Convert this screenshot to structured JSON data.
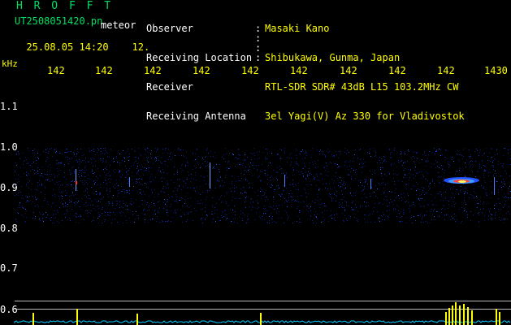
{
  "header": {
    "brand": "H R O F F T",
    "filename": "UT2508051420.pn",
    "mode": "meteor",
    "datetime": "25.08.05 14:20",
    "counter": "12.",
    "fields": [
      {
        "label": "Observer",
        "value": "Masaki Kano"
      },
      {
        "label": "Receiving Location",
        "value": "Shibukawa, Gunma, Japan"
      },
      {
        "label": "Receiver",
        "value": "RTL-SDR SDR# 43dB L15 103.2MHz CW"
      },
      {
        "label": "Receiving Antenna",
        "value": "3el Yagi(V) Az 330 for Vladivostok"
      }
    ]
  },
  "axes": {
    "y_unit": "kHz",
    "x_ticks": [
      "142",
      "142",
      "142",
      "142",
      "142",
      "142",
      "142",
      "142",
      "142",
      "1430"
    ],
    "y_ticks": [
      "1.1",
      "1.0",
      "0.9",
      "0.8",
      "0.7",
      "0.6"
    ]
  },
  "colors": {
    "brand": "#00e060",
    "text": "#ffffff",
    "accent": "#ffff00",
    "spectrum": "#00c8ff",
    "noise": "#0a1a8a"
  }
}
